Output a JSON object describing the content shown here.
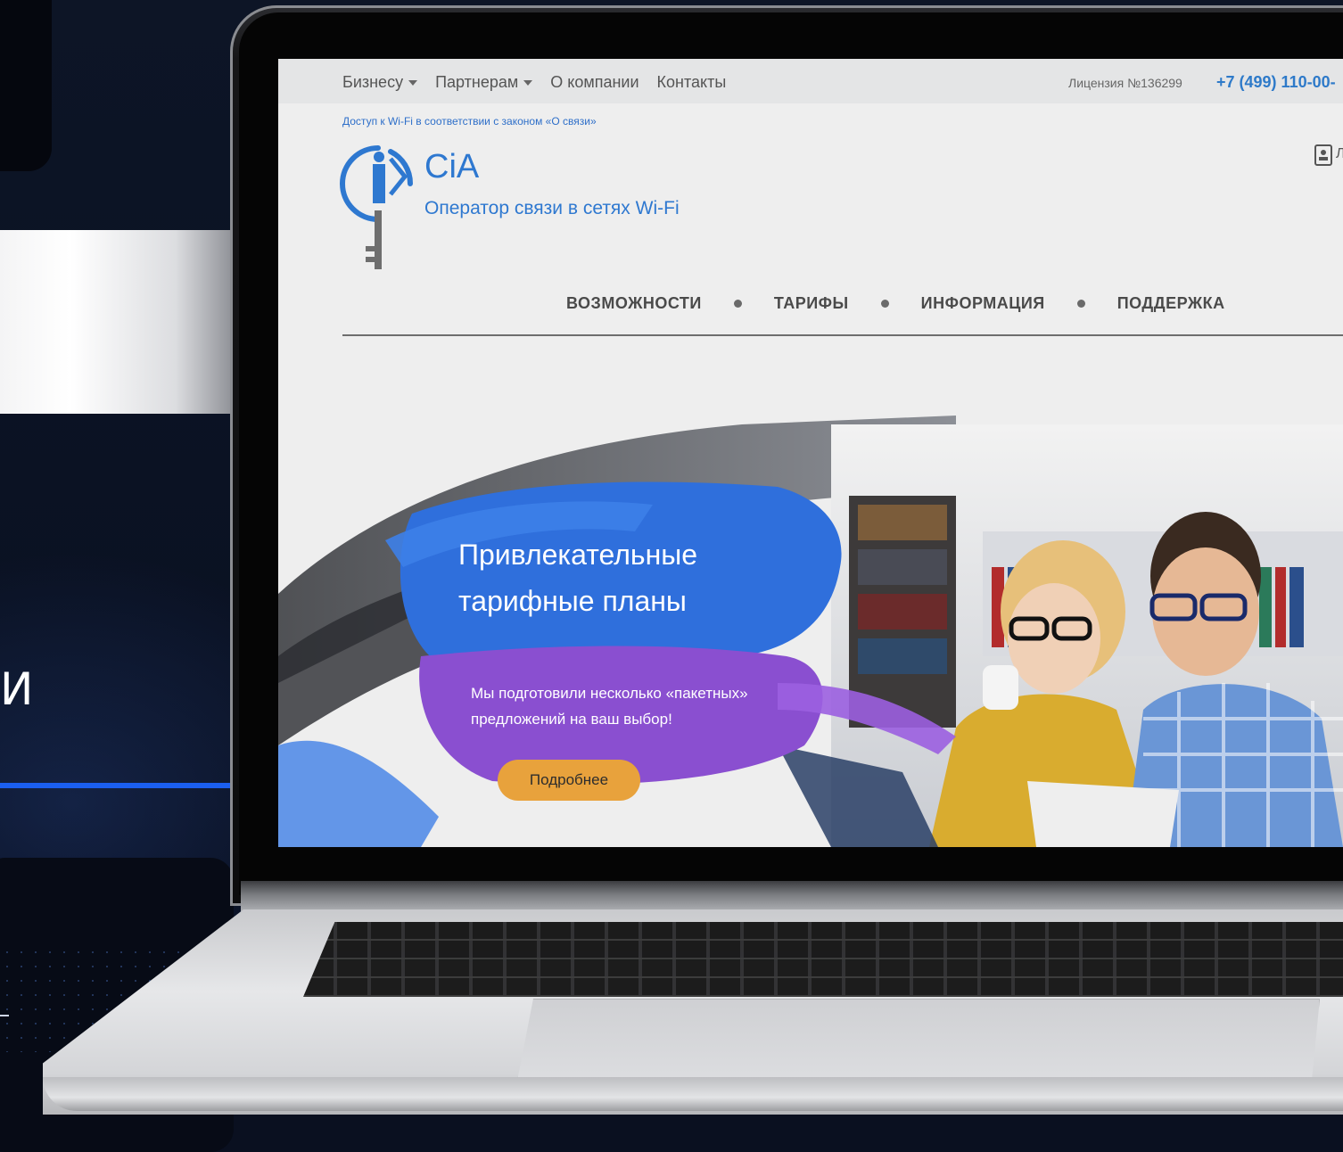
{
  "background": {
    "side_letter": "И",
    "accent_color": "#1b5ff0"
  },
  "site": {
    "topbar": {
      "nav": [
        {
          "label": "Бизнесу",
          "dropdown": true
        },
        {
          "label": "Партнерам",
          "dropdown": true
        },
        {
          "label": "О компании",
          "dropdown": false
        },
        {
          "label": "Контакты",
          "dropdown": false
        }
      ],
      "license": "Лицензия №136299",
      "phone": "+7 (499) 110-00-"
    },
    "notice": "Доступ к Wi-Fi в соответствии с законом «О связи»",
    "brand": {
      "name": "CiA",
      "tagline": "Оператор связи в сетях Wi-Fi",
      "color": "#2e78d0"
    },
    "account": {
      "icon": "account-card-icon",
      "label": "Л"
    },
    "main_nav": [
      "ВОЗМОЖНОСТИ",
      "ТАРИФЫ",
      "ИНФОРМАЦИЯ",
      "ПОДДЕРЖКА"
    ],
    "hero": {
      "title_line1": "Привлекательные",
      "title_line2": "тарифные планы",
      "subtitle_line1": "Мы подготовили несколько «пакетных»",
      "subtitle_line2": "предложений на ваш выбор!",
      "button": "Подробнее",
      "button_color": "#e8a23c",
      "brush_blue": "#2f6fdc",
      "brush_purple": "#8a4fd0"
    }
  }
}
